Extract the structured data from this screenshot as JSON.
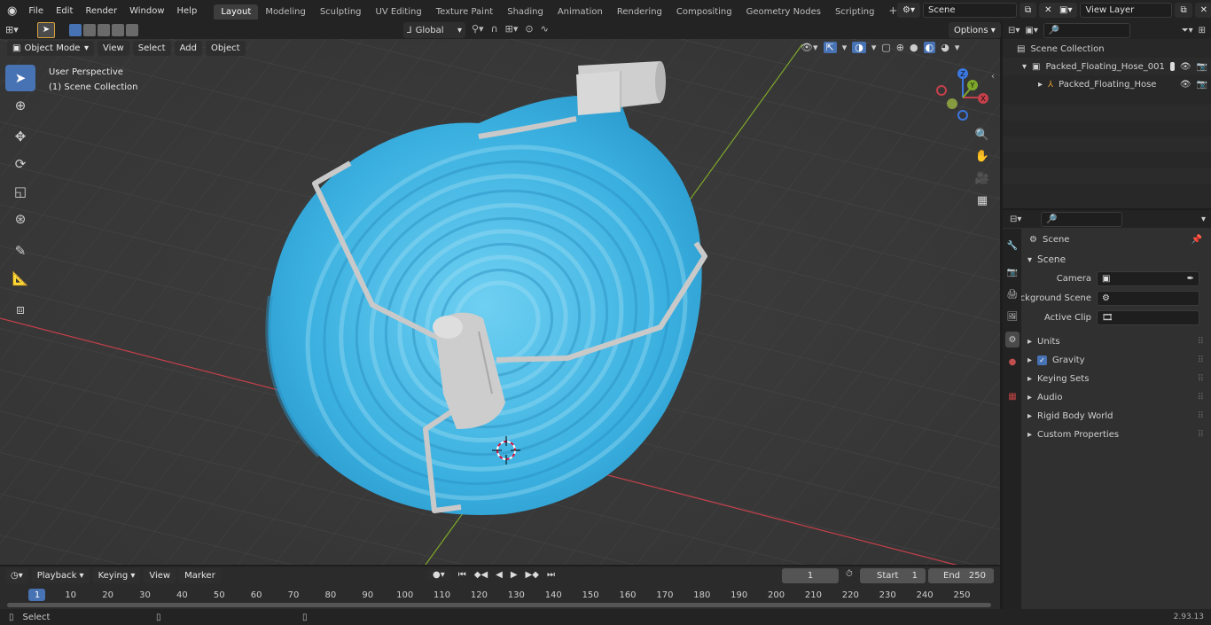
{
  "menu": {
    "items": [
      "File",
      "Edit",
      "Render",
      "Window",
      "Help"
    ]
  },
  "workspaces": [
    "Layout",
    "Modeling",
    "Sculpting",
    "UV Editing",
    "Texture Paint",
    "Shading",
    "Animation",
    "Rendering",
    "Compositing",
    "Geometry Nodes",
    "Scripting"
  ],
  "scene_field": "Scene",
  "view_layer_field": "View Layer",
  "header": {
    "mode": "Object Mode",
    "view": "View",
    "select": "Select",
    "add": "Add",
    "object": "Object",
    "orientation": "Global",
    "options": "Options"
  },
  "overlay_text": {
    "line1": "User Perspective",
    "line2": "(1) Scene Collection"
  },
  "gizmo": {
    "x": "X",
    "y": "Y",
    "z": "Z"
  },
  "colors": {
    "accent": "#4772b3",
    "hose": "#3ab0e0",
    "bracket": "#c9c9c9",
    "x_axis": "#c4404a",
    "y_axis": "#7ea82a"
  },
  "outliner": {
    "root": "Scene Collection",
    "items": [
      {
        "label": "Packed_Floating_Hose_001"
      },
      {
        "label": "Packed_Floating_Hose"
      }
    ]
  },
  "properties": {
    "header": "Scene",
    "panel": "Scene",
    "camera_label": "Camera",
    "bg_scene_label": "Background Scene",
    "active_clip_label": "Active Clip",
    "sections": [
      "Units",
      "Gravity",
      "Keying Sets",
      "Audio",
      "Rigid Body World",
      "Custom Properties"
    ]
  },
  "timeline": {
    "playback": "Playback",
    "keying": "Keying",
    "view": "View",
    "marker": "Marker",
    "current_frame": "1",
    "start_label": "Start",
    "start": "1",
    "end_label": "End",
    "end": "250",
    "ticks": [
      "1",
      "10",
      "20",
      "30",
      "40",
      "50",
      "60",
      "70",
      "80",
      "90",
      "100",
      "110",
      "120",
      "130",
      "140",
      "150",
      "160",
      "170",
      "180",
      "190",
      "200",
      "210",
      "220",
      "230",
      "240",
      "250"
    ]
  },
  "status": {
    "select": "Select",
    "version": "2.93.13"
  }
}
